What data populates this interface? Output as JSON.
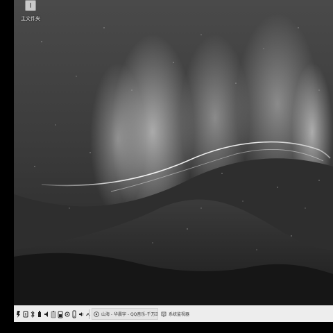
{
  "desktop": {
    "icons": [
      {
        "label": "主文件夹",
        "icon": "home-folder-icon"
      }
    ]
  },
  "taskbar": {
    "tray_icons": [
      "user-switch-icon",
      "keyboard-icon",
      "bluetooth-icon",
      "usb-icon",
      "volume-icon",
      "clipboard-icon",
      "battery-icon",
      "settings-icon",
      "phone-icon",
      "speaker-icon",
      "chevron-up-icon",
      "monitor-icon"
    ],
    "tasks": [
      {
        "label": "山海 - 华晨宇 - QQ音乐-千万正版音乐",
        "icon": "qq-music-icon"
      },
      {
        "label": "系统监视器",
        "icon": "system-monitor-icon"
      }
    ]
  },
  "colors": {
    "taskbar_bg": "#ededed",
    "desktop_bg": "#3a3a3a",
    "aurora_light": "#e6e6e6"
  }
}
